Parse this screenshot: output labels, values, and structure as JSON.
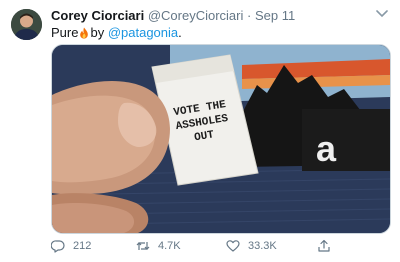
{
  "tweet": {
    "display_name": "Corey Ciorciari",
    "handle": "@CoreyCiorciari",
    "separator": "·",
    "date": "Sep 11",
    "text_before": "Pure",
    "text_middle": "by",
    "mention": "@patagonia",
    "text_after": ".",
    "emoji": "fire-icon",
    "media": {
      "label_text_lines": [
        "VOTE THE",
        "ASSHOLES",
        "OUT"
      ],
      "logo_fragment": "a"
    },
    "actions": {
      "replies": "212",
      "retweets": "4.7K",
      "likes": "33.3K"
    }
  },
  "colors": {
    "link": "#1b95e0",
    "muted": "#657786",
    "text": "#14171a"
  }
}
